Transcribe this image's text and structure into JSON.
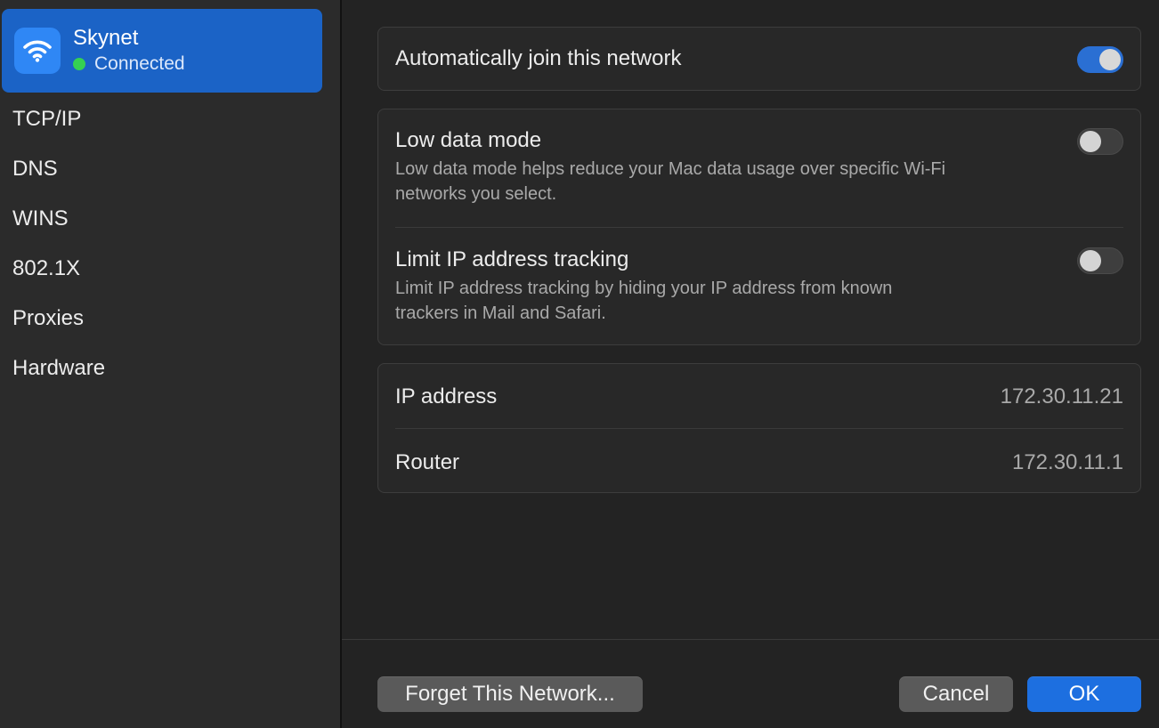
{
  "sidebar": {
    "network": {
      "name": "Skynet",
      "status": "Connected",
      "icon": "wifi-icon",
      "status_color": "#35d152",
      "highlight_color": "#1b63c6"
    },
    "items": [
      {
        "label": "TCP/IP"
      },
      {
        "label": "DNS"
      },
      {
        "label": "WINS"
      },
      {
        "label": "802.1X"
      },
      {
        "label": "Proxies"
      },
      {
        "label": "Hardware"
      }
    ]
  },
  "main": {
    "auto_join": {
      "label": "Automatically join this network",
      "enabled": true
    },
    "low_data": {
      "label": "Low data mode",
      "description_line1": "Low data mode helps reduce your Mac data usage over specific Wi-Fi",
      "description_line2": "networks you select.",
      "enabled": false
    },
    "limit_ip": {
      "label": "Limit IP address tracking",
      "description_line1": "Limit IP address tracking by hiding your IP address from known",
      "description_line2": "trackers in Mail and Safari.",
      "enabled": false
    },
    "info": {
      "ip_label": "IP address",
      "ip_value": "172.30.11.21",
      "router_label": "Router",
      "router_value": "172.30.11.1"
    }
  },
  "footer": {
    "forget_label": "Forget This Network...",
    "cancel_label": "Cancel",
    "ok_label": "OK",
    "accent_color": "#1d6fe0"
  }
}
